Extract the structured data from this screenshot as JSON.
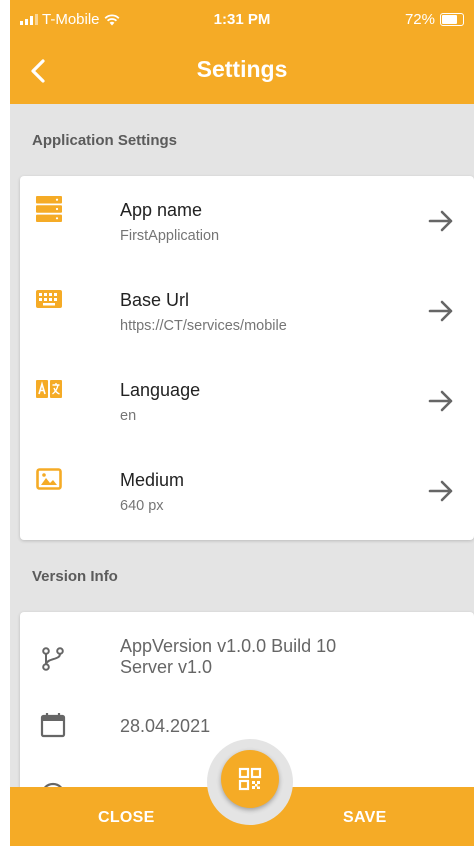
{
  "status_bar": {
    "carrier": "T-Mobile",
    "time": "1:31 PM",
    "battery": "72%"
  },
  "header": {
    "title": "Settings"
  },
  "application_settings": {
    "section_title": "Application Settings",
    "items": [
      {
        "title": "App name",
        "value": "FirstApplication",
        "icon": "storage-icon"
      },
      {
        "title": "Base Url",
        "value": "https://CT/services/mobile",
        "icon": "keyboard-icon"
      },
      {
        "title": "Language",
        "value": "en",
        "icon": "translate-icon"
      },
      {
        "title": "Medium",
        "value": "640 px",
        "icon": "image-icon"
      }
    ]
  },
  "version_info": {
    "section_title": "Version Info",
    "app_version": "AppVersion v1.0.0 Build 10",
    "server_version": "Server v1.0",
    "date": "28.04.2021"
  },
  "bottom_bar": {
    "close_label": "CLOSE",
    "save_label": "SAVE"
  },
  "colors": {
    "accent": "#f5ab26",
    "background": "#e4e4e4",
    "card": "#ffffff"
  }
}
